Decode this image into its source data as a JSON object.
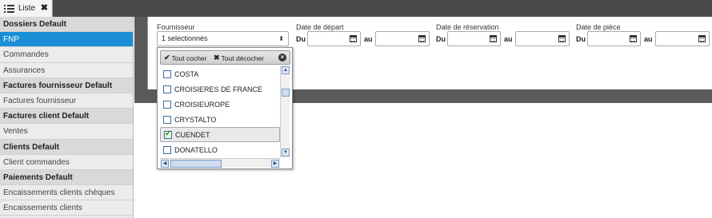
{
  "tab": {
    "label": "Liste",
    "close": "✖"
  },
  "sidebar": {
    "rows": [
      {
        "label": "Dossiers Default",
        "kind": "header"
      },
      {
        "label": "FNP",
        "kind": "item",
        "active": true
      },
      {
        "label": "Commandes",
        "kind": "item"
      },
      {
        "label": "Assurances",
        "kind": "item"
      },
      {
        "label": "Factures fournisseur Default",
        "kind": "header"
      },
      {
        "label": "Factures fournisseur",
        "kind": "item"
      },
      {
        "label": "Factures client Default",
        "kind": "header"
      },
      {
        "label": "Ventes",
        "kind": "item"
      },
      {
        "label": "Clients Default",
        "kind": "header"
      },
      {
        "label": "Client commandes",
        "kind": "item"
      },
      {
        "label": "Paiements Default",
        "kind": "header"
      },
      {
        "label": "Encaissements clients chèques",
        "kind": "item"
      },
      {
        "label": "Encaissements clients",
        "kind": "item"
      }
    ]
  },
  "filters": {
    "fournisseur": {
      "label": "Fournisseur",
      "value": "1 selectionnés",
      "arrow": "⬍"
    },
    "date_depart": {
      "label": "Date de départ",
      "from": "Du",
      "to": "au"
    },
    "date_reservation": {
      "label": "Date de réservation",
      "from": "Du",
      "to": "au"
    },
    "date_piece": {
      "label": "Date de pièce",
      "from": "Du",
      "to": "au"
    }
  },
  "dropdown": {
    "check_all": "Tout cocher",
    "uncheck_all": "Tout décocher",
    "options": [
      {
        "label": "COSTA",
        "checked": false
      },
      {
        "label": "CROISIERES DE FRANCE",
        "checked": false
      },
      {
        "label": "CROISIEUROPE",
        "checked": false
      },
      {
        "label": "CRYSTALTO",
        "checked": false
      },
      {
        "label": "CUENDET",
        "checked": true
      },
      {
        "label": "DONATELLO",
        "checked": false
      }
    ]
  },
  "colors": {
    "accent": "#1a8fd6",
    "topbar": "#4a4a4a"
  }
}
